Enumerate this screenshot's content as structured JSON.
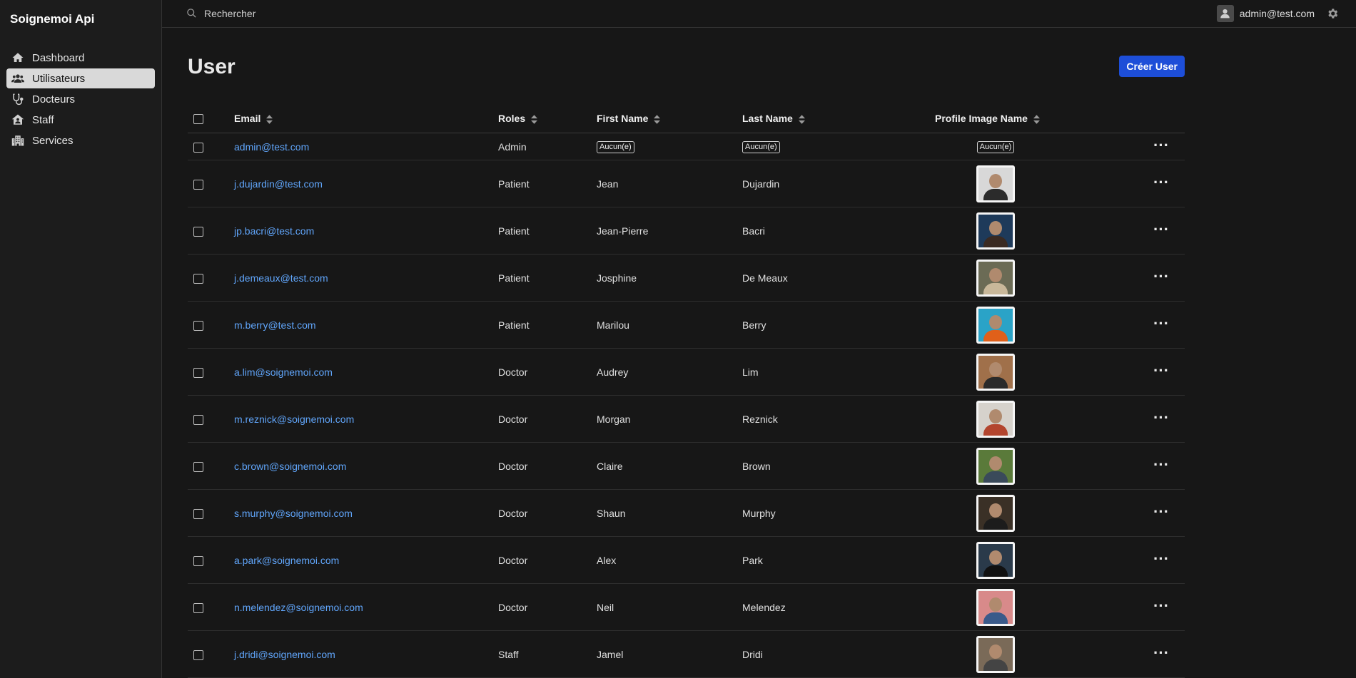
{
  "app": {
    "title": "Soignemoi Api"
  },
  "sidebar": {
    "items": [
      {
        "label": "Dashboard",
        "icon": "home-icon",
        "active": false
      },
      {
        "label": "Utilisateurs",
        "icon": "users-icon",
        "active": true
      },
      {
        "label": "Docteurs",
        "icon": "stethoscope-icon",
        "active": false
      },
      {
        "label": "Staff",
        "icon": "house-user-icon",
        "active": false
      },
      {
        "label": "Services",
        "icon": "building-icon",
        "active": false
      }
    ]
  },
  "topbar": {
    "search_placeholder": "Rechercher",
    "user_email": "admin@test.com"
  },
  "page": {
    "title": "User",
    "create_button": "Créer User"
  },
  "table": {
    "columns": [
      "Email",
      "Roles",
      "First Name",
      "Last Name",
      "Profile Image Name"
    ],
    "empty_label": "Aucun(e)",
    "rows": [
      {
        "email": "admin@test.com",
        "role": "Admin",
        "first": "Aucun(e)",
        "last": "Aucun(e)",
        "image": "Aucun(e)",
        "has_image": false,
        "bg": "#000000",
        "fg": "#000000"
      },
      {
        "email": "j.dujardin@test.com",
        "role": "Patient",
        "first": "Jean",
        "last": "Dujardin",
        "has_image": true,
        "bg": "#d8d8d8",
        "fg": "#2b2b2b"
      },
      {
        "email": "jp.bacri@test.com",
        "role": "Patient",
        "first": "Jean-Pierre",
        "last": "Bacri",
        "has_image": true,
        "bg": "#1e3a5a",
        "fg": "#3a2a22"
      },
      {
        "email": "j.demeaux@test.com",
        "role": "Patient",
        "first": "Josphine",
        "last": "De Meaux",
        "has_image": true,
        "bg": "#6b6b55",
        "fg": "#c9b89a"
      },
      {
        "email": "m.berry@test.com",
        "role": "Patient",
        "first": "Marilou",
        "last": "Berry",
        "has_image": true,
        "bg": "#2aa3c7",
        "fg": "#e0601a"
      },
      {
        "email": "a.lim@soignemoi.com",
        "role": "Doctor",
        "first": "Audrey",
        "last": "Lim",
        "has_image": true,
        "bg": "#a0704a",
        "fg": "#2a2a2a"
      },
      {
        "email": "m.reznick@soignemoi.com",
        "role": "Doctor",
        "first": "Morgan",
        "last": "Reznick",
        "has_image": true,
        "bg": "#d6d2cc",
        "fg": "#b3452e"
      },
      {
        "email": "c.brown@soignemoi.com",
        "role": "Doctor",
        "first": "Claire",
        "last": "Brown",
        "has_image": true,
        "bg": "#5a7a3a",
        "fg": "#3a4a5a"
      },
      {
        "email": "s.murphy@soignemoi.com",
        "role": "Doctor",
        "first": "Shaun",
        "last": "Murphy",
        "has_image": true,
        "bg": "#3a3026",
        "fg": "#1c1c1c"
      },
      {
        "email": "a.park@soignemoi.com",
        "role": "Doctor",
        "first": "Alex",
        "last": "Park",
        "has_image": true,
        "bg": "#2a3a4a",
        "fg": "#111111"
      },
      {
        "email": "n.melendez@soignemoi.com",
        "role": "Doctor",
        "first": "Neil",
        "last": "Melendez",
        "has_image": true,
        "bg": "#d88a8a",
        "fg": "#3a5a8a"
      },
      {
        "email": "j.dridi@soignemoi.com",
        "role": "Staff",
        "first": "Jamel",
        "last": "Dridi",
        "has_image": true,
        "bg": "#7a6a58",
        "fg": "#444444"
      }
    ]
  }
}
